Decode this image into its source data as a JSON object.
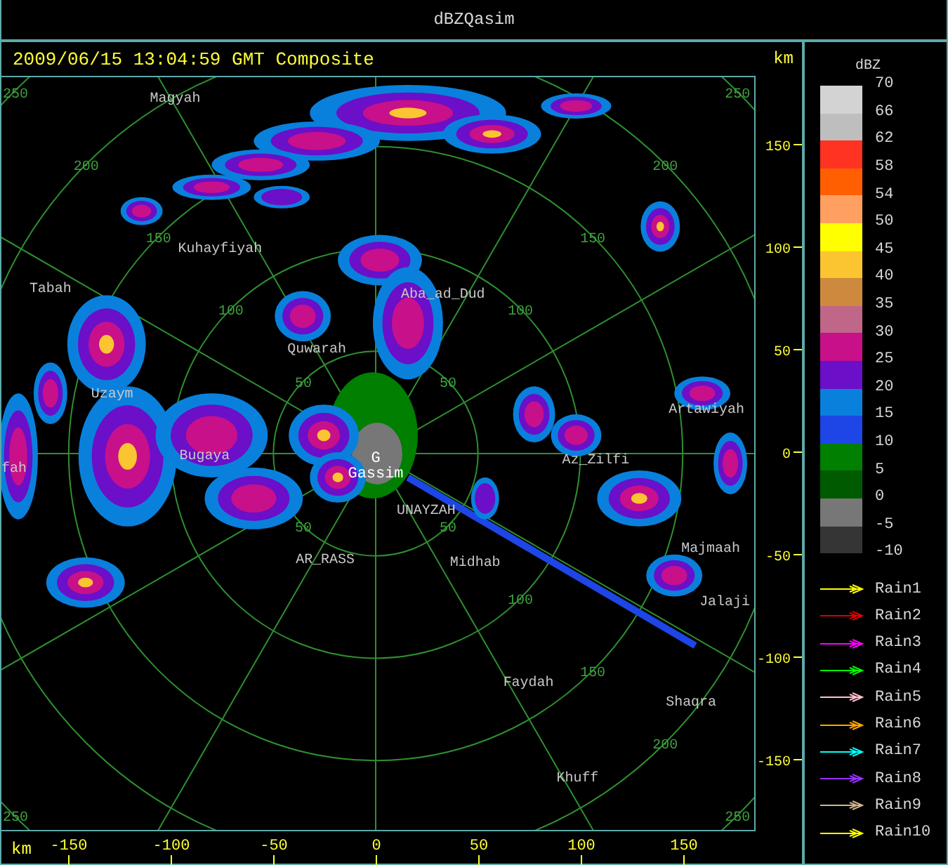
{
  "window": {
    "title": "dBZQasim"
  },
  "header": {
    "timestamp": "2009/06/15 13:04:59 GMT Composite",
    "unit": "km"
  },
  "map": {
    "ring_labels": [
      {
        "text": "250",
        "kind": "nw"
      },
      {
        "text": "200",
        "kind": "nw"
      },
      {
        "text": "150",
        "kind": "nw"
      },
      {
        "text": "100",
        "kind": "nw"
      },
      {
        "text": "50",
        "kind": "nw"
      },
      {
        "text": "250",
        "kind": "ne"
      },
      {
        "text": "200",
        "kind": "ne"
      },
      {
        "text": "150",
        "kind": "ne"
      },
      {
        "text": "100",
        "kind": "ne"
      },
      {
        "text": "50",
        "kind": "ne"
      },
      {
        "text": "50",
        "kind": "sw"
      },
      {
        "text": "250",
        "kind": "sw"
      },
      {
        "text": "50",
        "kind": "se"
      },
      {
        "text": "100",
        "kind": "se"
      },
      {
        "text": "150",
        "kind": "se"
      },
      {
        "text": "200",
        "kind": "se"
      },
      {
        "text": "250",
        "kind": "se"
      }
    ],
    "cities": [
      {
        "name": "Magyah"
      },
      {
        "name": "Kuhayfiyah"
      },
      {
        "name": "Tabah"
      },
      {
        "name": "Aba_ad_Dud"
      },
      {
        "name": "Quwarah"
      },
      {
        "name": "Uzaym"
      },
      {
        "name": "Artawiyah"
      },
      {
        "name": "Bugaya"
      },
      {
        "name": "fah"
      },
      {
        "name": "Az_Zilfi"
      },
      {
        "name": "UNAYZAH"
      },
      {
        "name": "Majmaah"
      },
      {
        "name": "AR_RASS"
      },
      {
        "name": "Midhab"
      },
      {
        "name": "Jalaji"
      },
      {
        "name": "Faydah"
      },
      {
        "name": "Shaqra"
      },
      {
        "name": "Khuff"
      }
    ],
    "site": {
      "marker": "G",
      "name": "Gassim"
    }
  },
  "y_axis": {
    "labels": [
      "150",
      "100",
      "50",
      "0",
      "-50",
      "-100",
      "-150"
    ]
  },
  "x_axis": {
    "unit": "km",
    "labels": [
      "-150",
      "-100",
      "-50",
      "0",
      "50",
      "100",
      "150"
    ]
  },
  "legend": {
    "title": "dBZ",
    "swatches": [
      {
        "color": "#d3d3d3"
      },
      {
        "color": "#bebebe"
      },
      {
        "color": "#ff3322"
      },
      {
        "color": "#ff5f00"
      },
      {
        "color": "#ffa060"
      },
      {
        "color": "#ffff00"
      },
      {
        "color": "#fbc531"
      },
      {
        "color": "#cd8a3e"
      },
      {
        "color": "#c06688"
      },
      {
        "color": "#c8108a"
      },
      {
        "color": "#6b0fc8"
      },
      {
        "color": "#0a80dd"
      },
      {
        "color": "#1e46e6"
      },
      {
        "color": "#007f00"
      },
      {
        "color": "#005a00"
      },
      {
        "color": "#777777"
      },
      {
        "color": "#353535"
      }
    ],
    "scale_labels": [
      "70",
      "66",
      "62",
      "58",
      "54",
      "50",
      "45",
      "40",
      "35",
      "30",
      "25",
      "20",
      "15",
      "10",
      "5",
      "0",
      "-5",
      "-10"
    ],
    "tracks": [
      {
        "label": "Rain1",
        "color": "#ffff00"
      },
      {
        "label": "Rain2",
        "color": "#e00000"
      },
      {
        "label": "Rain3",
        "color": "#ff00ff"
      },
      {
        "label": "Rain4",
        "color": "#00ff00"
      },
      {
        "label": "Rain5",
        "color": "#ffc0cb"
      },
      {
        "label": "Rain6",
        "color": "#ffa500"
      },
      {
        "label": "Rain7",
        "color": "#00ffff"
      },
      {
        "label": "Rain8",
        "color": "#9933ff"
      },
      {
        "label": "Rain9",
        "color": "#d2b48c"
      },
      {
        "label": "Rain10",
        "color": "#ffff00"
      }
    ]
  }
}
